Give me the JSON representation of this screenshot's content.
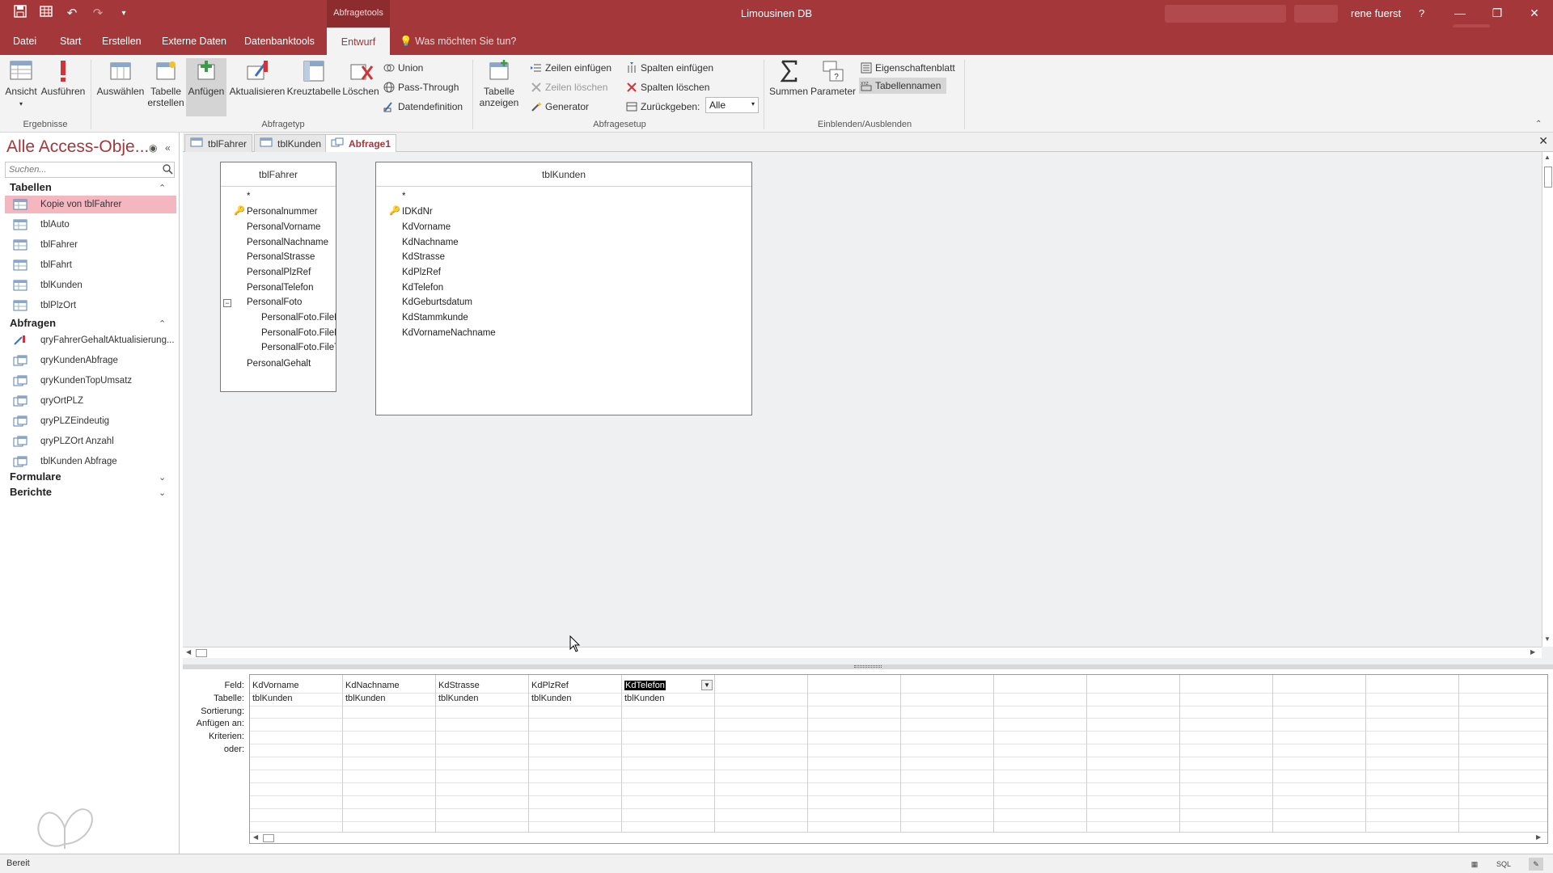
{
  "window": {
    "context_tab": "Abfragetools",
    "title": "Limousinen DB",
    "user": "rene fuerst",
    "help": "?"
  },
  "ribbon_tabs": [
    "Datei",
    "Start",
    "Erstellen",
    "Externe Daten",
    "Datenbanktools",
    "Entwurf"
  ],
  "active_tab": "Entwurf",
  "tell_me": "Was möchten Sie tun?",
  "ribbon": {
    "ergebnisse": {
      "label": "Ergebnisse",
      "ansicht": "Ansicht",
      "ausfuehren": "Ausführen"
    },
    "abfragetyp": {
      "label": "Abfragetyp",
      "auswaehlen": "Auswählen",
      "tabelle_erstellen_1": "Tabelle",
      "tabelle_erstellen_2": "erstellen",
      "anfuegen": "Anfügen",
      "aktualisieren": "Aktualisieren",
      "kreuztabelle": "Kreuztabelle",
      "loeschen": "Löschen",
      "union": "Union",
      "pass_through": "Pass-Through",
      "datendefinition": "Datendefinition"
    },
    "abfragesetup": {
      "label": "Abfragesetup",
      "tabelle_anzeigen_1": "Tabelle",
      "tabelle_anzeigen_2": "anzeigen",
      "zeilen_einfuegen": "Zeilen einfügen",
      "zeilen_loeschen": "Zeilen löschen",
      "generator": "Generator",
      "spalten_einfuegen": "Spalten einfügen",
      "spalten_loeschen": "Spalten löschen",
      "zurueckgeben": "Zurückgeben:",
      "zurueckgeben_value": "Alle"
    },
    "einblenden": {
      "label": "Einblenden/Ausblenden",
      "summen": "Summen",
      "parameter": "Parameter",
      "eigenschaftenblatt": "Eigenschaftenblatt",
      "tabellennamen": "Tabellennamen"
    }
  },
  "nav": {
    "title": "Alle Access-Obje...",
    "search_placeholder": "Suchen...",
    "groups": {
      "tabellen": "Tabellen",
      "abfragen": "Abfragen",
      "formulare": "Formulare",
      "berichte": "Berichte"
    },
    "tables": [
      "Kopie von tblFahrer",
      "tblAuto",
      "tblFahrer",
      "tblFahrt",
      "tblKunden",
      "tblPlzOrt"
    ],
    "queries": [
      "qryFahrerGehaltAktualisierung...",
      "qryKundenAbfrage",
      "qryKundenTopUmsatz",
      "qryOrtPLZ",
      "qryPLZEindeutig",
      "qryPLZOrt Anzahl",
      "tblKunden Abfrage"
    ]
  },
  "doc_tabs": [
    "tblFahrer",
    "tblKunden",
    "Abfrage1"
  ],
  "tables": {
    "fahrer": {
      "title": "tblFahrer",
      "fields": [
        "*",
        "Personalnummer",
        "PersonalVorname",
        "PersonalNachname",
        "PersonalStrasse",
        "PersonalPlzRef",
        "PersonalTelefon",
        "PersonalFoto",
        "PersonalFoto.FileD",
        "PersonalFoto.FileN",
        "PersonalFoto.FileT",
        "PersonalGehalt"
      ]
    },
    "kunden": {
      "title": "tblKunden",
      "fields": [
        "*",
        "IDKdNr",
        "KdVorname",
        "KdNachname",
        "KdStrasse",
        "KdPlzRef",
        "KdTelefon",
        "KdGeburtsdatum",
        "KdStammkunde",
        "KdVornameNachname"
      ]
    }
  },
  "qbe": {
    "row_labels": [
      "Feld:",
      "Tabelle:",
      "Sortierung:",
      "Anfügen an:",
      "Kriterien:",
      "oder:"
    ],
    "columns": [
      {
        "field": "KdVorname",
        "table": "tblKunden"
      },
      {
        "field": "KdNachname",
        "table": "tblKunden"
      },
      {
        "field": "KdStrasse",
        "table": "tblKunden"
      },
      {
        "field": "KdPlzRef",
        "table": "tblKunden"
      },
      {
        "field": "KdTelefon",
        "table": "tblKunden"
      }
    ]
  },
  "status": {
    "text": "Bereit",
    "sql": "SQL"
  },
  "colors": {
    "accent": "#a4373a",
    "selected_nav": "#f4b7c0"
  }
}
